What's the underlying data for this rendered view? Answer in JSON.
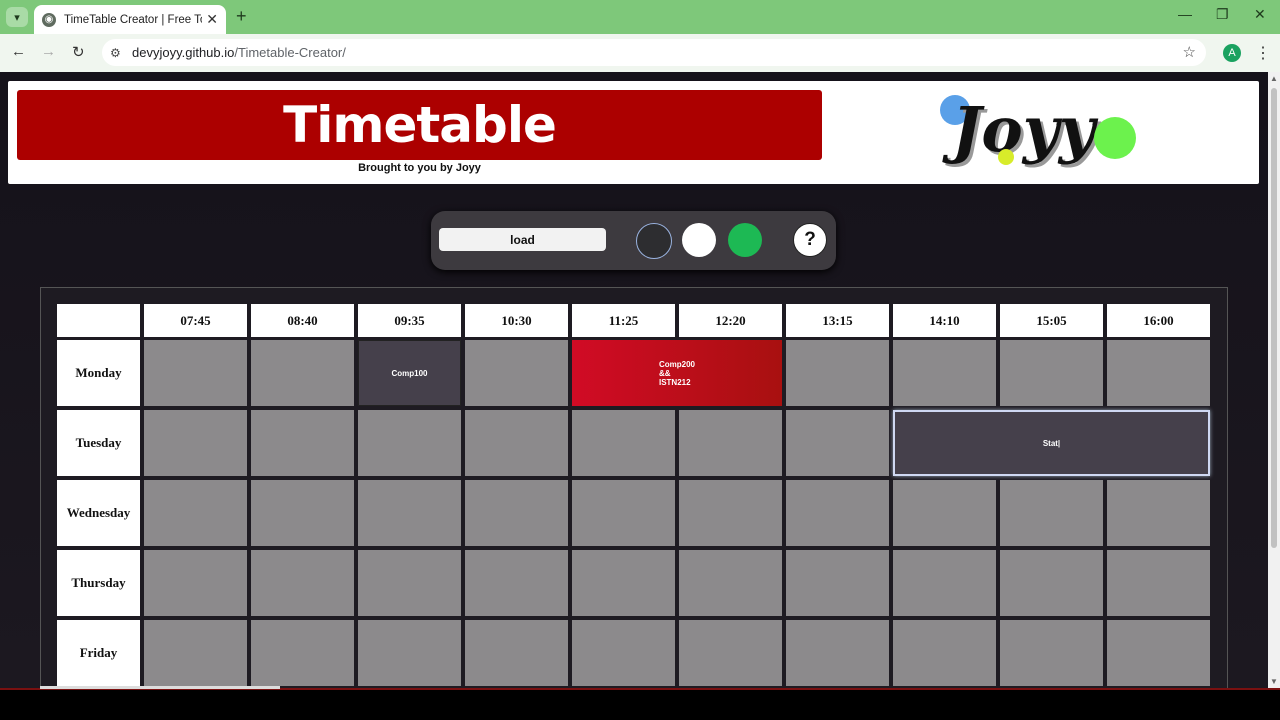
{
  "browser": {
    "tab_title": "TimeTable Creator | Free Tool fo",
    "url_host": "devyjoyy.github.io",
    "url_path": "/Timetable-Creator/",
    "profile_initial": "A"
  },
  "header": {
    "title": "Timetable",
    "byline": "Brought to you by Joyy",
    "logo_text": "Joyy"
  },
  "controls": {
    "load_label": "load",
    "help_label": "?",
    "swatches": [
      "#2d2d30",
      "#ffffff",
      "#1db954"
    ]
  },
  "timetable": {
    "times": [
      "07:45",
      "08:40",
      "09:35",
      "10:30",
      "11:25",
      "12:20",
      "13:15",
      "14:10",
      "15:05",
      "16:00"
    ],
    "days": [
      "Monday",
      "Tuesday",
      "Wednesday",
      "Thursday",
      "Friday"
    ],
    "events": [
      {
        "day": "Monday",
        "start": "09:35",
        "span": 1,
        "label": "Comp100",
        "style": "dark"
      },
      {
        "day": "Monday",
        "start": "11:25",
        "span": 2,
        "lines": [
          "Comp200",
          "&&",
          "ISTN212"
        ],
        "style": "red"
      },
      {
        "day": "Tuesday",
        "start": "14:10",
        "span": 3,
        "label": "Stat|",
        "style": "selected"
      }
    ]
  }
}
